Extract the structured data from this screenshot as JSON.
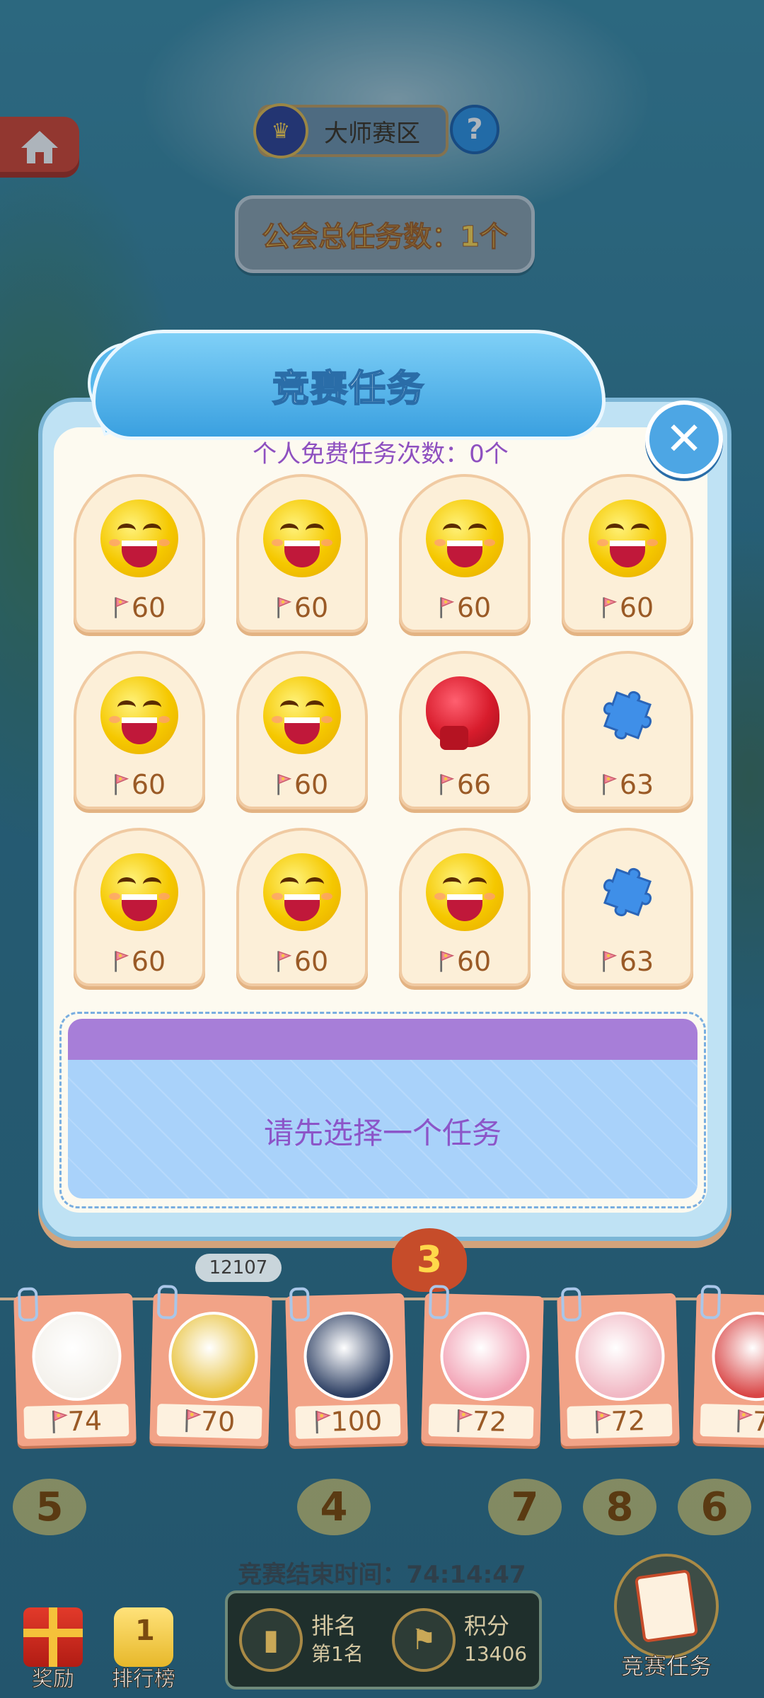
{
  "header": {
    "zone_label": "大师赛区",
    "help_symbol": "?",
    "guild_total_tasks": "公会总任务数：1个"
  },
  "dialog": {
    "title": "竞赛任务",
    "close_symbol": "✕",
    "free_count": "个人免费任务次数：0个",
    "tasks": [
      {
        "icon": "smile-emoji-icon",
        "score": "60"
      },
      {
        "icon": "smile-emoji-icon",
        "score": "60"
      },
      {
        "icon": "smile-emoji-icon",
        "score": "60"
      },
      {
        "icon": "smile-emoji-icon",
        "score": "60"
      },
      {
        "icon": "smile-emoji-icon",
        "score": "60"
      },
      {
        "icon": "smile-emoji-icon",
        "score": "60"
      },
      {
        "icon": "boxing-glove-icon",
        "score": "66"
      },
      {
        "icon": "puzzle-piece-icon",
        "score": "63"
      },
      {
        "icon": "smile-emoji-icon",
        "score": "60"
      },
      {
        "icon": "smile-emoji-icon",
        "score": "60"
      },
      {
        "icon": "smile-emoji-icon",
        "score": "60"
      },
      {
        "icon": "puzzle-piece-icon",
        "score": "63"
      }
    ],
    "selection_hint": "请先选择一个任务"
  },
  "board": {
    "rank_tag": "12107",
    "marker_number": "3",
    "players": [
      {
        "avatar": "grandma-avatar-icon",
        "score": "74",
        "color": "#f3f0ea"
      },
      {
        "avatar": "dog-crown-avatar-icon",
        "score": "70",
        "color": "#e8c23c"
      },
      {
        "avatar": "husky-avatar-icon",
        "score": "100",
        "color": "#2d3f63"
      },
      {
        "avatar": "pink-hat-kid-avatar-icon",
        "score": "72",
        "color": "#f2a1b4"
      },
      {
        "avatar": "bird-avatar-icon",
        "score": "72",
        "color": "#f1b8c4"
      },
      {
        "avatar": "sunglasses-avatar-icon",
        "score": "7",
        "color": "#d94646"
      }
    ],
    "bubbles": [
      "5",
      "4",
      "7",
      "8",
      "6"
    ]
  },
  "footer": {
    "end_time": "竞赛结束时间：74:14:47",
    "rank_label": "排名",
    "rank_value": "第1名",
    "points_label": "积分",
    "points_value": "13406",
    "nav_reward": "奖励",
    "nav_leaderboard": "排行榜",
    "nav_tasks": "竞赛任务"
  },
  "colors": {
    "panel_border": "#7cb6d6",
    "card_bg": "#fcefd8",
    "accent_purple": "#8e50c0",
    "score_brown": "#9a5a26"
  }
}
